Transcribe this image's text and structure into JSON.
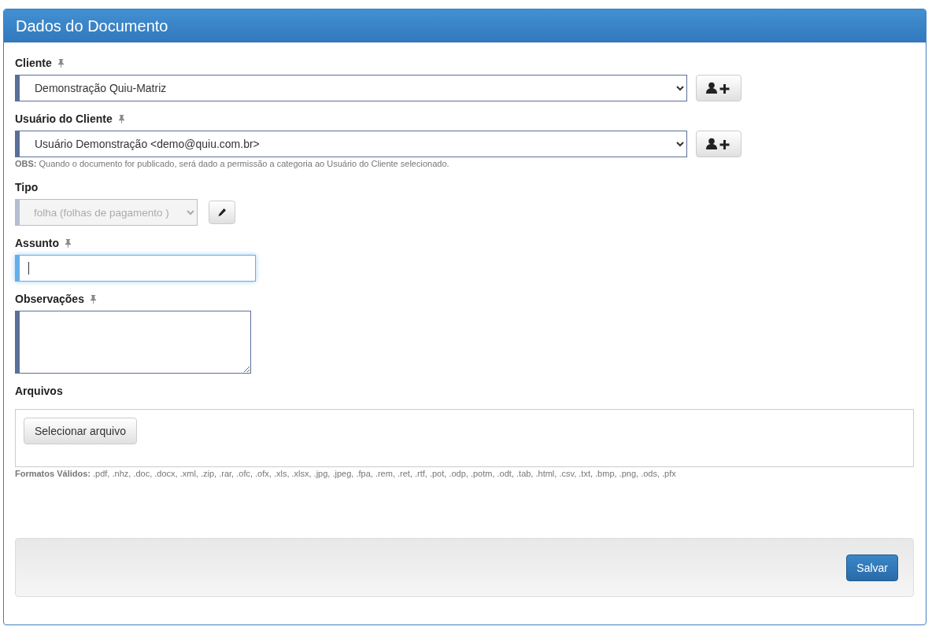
{
  "panel": {
    "title": "Dados do Documento"
  },
  "fields": [
    {
      "kind": "select",
      "label": "Cliente",
      "pinned": true,
      "value": "Demonstração Quiu-Matriz",
      "disabled": false,
      "button": {
        "kind": "add-user"
      },
      "wide": true
    },
    {
      "kind": "select",
      "label": "Usuário do Cliente",
      "pinned": true,
      "value": "Usuário Demonstração <demo@quiu.com.br>",
      "disabled": false,
      "button": {
        "kind": "add-user"
      },
      "wide": true,
      "note": "**OBS:** Quando o documento for publicado, será dado a permissão a categoria ao Usuário do Cliente selecionado."
    },
    {
      "kind": "select",
      "label": "Tipo",
      "pinned": false,
      "value": "folha (folhas de pagamento )",
      "disabled": true,
      "button": {
        "kind": "edit"
      },
      "wide": false
    },
    {
      "kind": "input",
      "label": "Assunto",
      "pinned": true,
      "focused": true
    },
    {
      "kind": "textarea",
      "label": "Observações",
      "pinned": true,
      "focused": false
    },
    {
      "kind": "file",
      "label": "Arquivos",
      "pinned": false,
      "button_label": "Selecionar arquivo",
      "note": "**Formatos Válidos:** .pdf, .nhz, .doc, .docx, .xml, .zip, .rar, .ofc, .ofx, .xls, .xlsx, .jpg, .jpeg, .fpa, .rem, .ret, .rtf, .pot, .odp, .potm, .odt, .tab, .html, .csv, .txt, .bmp, .png, .ods, .pfx"
    }
  ],
  "footer": {
    "save_button": "Salvar"
  }
}
